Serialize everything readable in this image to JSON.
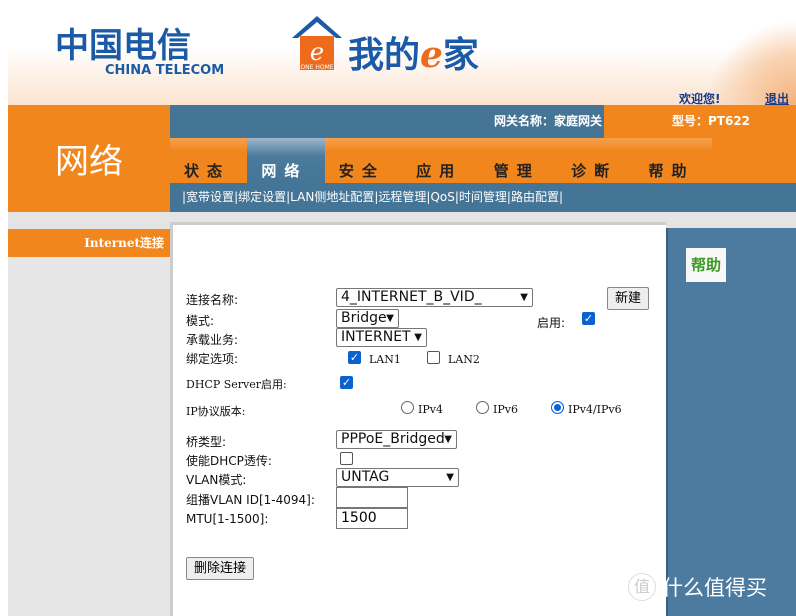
{
  "header": {
    "brand_cn": "中国电信",
    "brand_en": "CHINA TELECOM",
    "product_badge": "ONE HOME",
    "product": "我的",
    "product_e": "e",
    "product_tail": "家",
    "welcome": "欢迎您!",
    "logout": "退出"
  },
  "section_title": "网络",
  "gateway": {
    "name_label": "网关名称：家庭网关",
    "model_label": "型号：PT622"
  },
  "tabs": [
    {
      "label": "状态"
    },
    {
      "label": "网络",
      "active": true
    },
    {
      "label": "安全"
    },
    {
      "label": "应用"
    },
    {
      "label": "管理"
    },
    {
      "label": "诊断"
    },
    {
      "label": "帮助"
    }
  ],
  "subnav": [
    "宽带设置",
    "绑定设置",
    "LAN侧地址配置",
    "远程管理",
    "QoS",
    "时间管理",
    "路由配置"
  ],
  "sidebar": {
    "items": [
      {
        "label": "Internet连接",
        "active": true
      }
    ]
  },
  "help": {
    "title": "帮助"
  },
  "form": {
    "connection_name": {
      "label": "连接名称:",
      "value": "4_INTERNET_B_VID_"
    },
    "new_button": "新建",
    "mode": {
      "label": "模式:",
      "value": "Bridge"
    },
    "enable": {
      "label": "启用:",
      "checked": true
    },
    "service": {
      "label": "承载业务:",
      "value": "INTERNET"
    },
    "binding": {
      "label": "绑定选项:",
      "options": [
        {
          "label": "LAN1",
          "checked": true
        },
        {
          "label": "LAN2",
          "checked": false
        }
      ]
    },
    "dhcp_server": {
      "label": "DHCP Server启用:",
      "checked": true
    },
    "ip_version": {
      "label": "IP协议版本:",
      "options": [
        "IPv4",
        "IPv6",
        "IPv4/IPv6"
      ],
      "selected": "IPv4/IPv6"
    },
    "bridge_type": {
      "label": "桥类型:",
      "value": "PPPoE_Bridged"
    },
    "dhcp_passthrough": {
      "label": "使能DHCP透传:",
      "checked": false
    },
    "vlan_mode": {
      "label": "VLAN模式:",
      "value": "UNTAG"
    },
    "mcast_vlan": {
      "label": "组播VLAN ID[1-4094]:",
      "value": ""
    },
    "mtu": {
      "label": "MTU[1-1500]:",
      "value": "1500"
    },
    "delete_button": "删除连接"
  },
  "watermark": {
    "seal": "值",
    "text": "什么值得买"
  },
  "colors": {
    "orange": "#f0861c",
    "steel_blue": "#447596",
    "help_green": "#3a9a22"
  }
}
